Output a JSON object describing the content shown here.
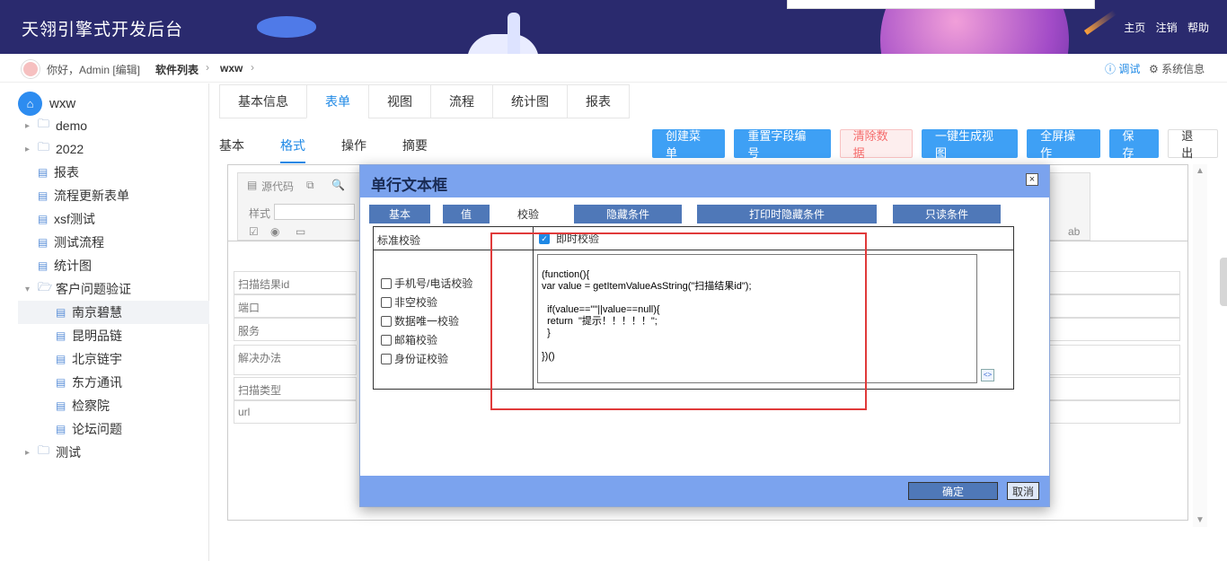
{
  "header": {
    "title": "天翎引擎式开发后台",
    "links": [
      "主页",
      "注销",
      "帮助"
    ]
  },
  "crumbs": {
    "greeting": "你好，Admin [编辑]",
    "items": [
      "软件列表",
      "wxw"
    ],
    "debug": "ⓘ 调试",
    "sysinfo": "⚙ 系统信息"
  },
  "sidebar": {
    "root": "wxw",
    "items": [
      {
        "label": "demo",
        "type": "folder"
      },
      {
        "label": "2022",
        "type": "folder"
      },
      {
        "label": "报表",
        "type": "doc"
      },
      {
        "label": "流程更新表单",
        "type": "doc"
      },
      {
        "label": "xsf测试",
        "type": "doc"
      },
      {
        "label": "测试流程",
        "type": "doc"
      },
      {
        "label": "统计图",
        "type": "doc"
      },
      {
        "label": "客户问题验证",
        "type": "folder-open"
      },
      {
        "label": "南京碧慧",
        "type": "doc-child",
        "active": true
      },
      {
        "label": "昆明品链",
        "type": "doc-child"
      },
      {
        "label": "北京链宇",
        "type": "doc-child"
      },
      {
        "label": "东方通讯",
        "type": "doc-child"
      },
      {
        "label": "检察院",
        "type": "doc-child"
      },
      {
        "label": "论坛问题",
        "type": "doc-child"
      },
      {
        "label": "测试",
        "type": "folder"
      }
    ]
  },
  "tabs": [
    "基本信息",
    "表单",
    "视图",
    "流程",
    "统计图",
    "报表"
  ],
  "active_tab": "表单",
  "subtabs": [
    "基本",
    "格式",
    "操作",
    "摘要"
  ],
  "active_subtab": "格式",
  "actions": [
    "创建菜单",
    "重置字段编号",
    "清除数据",
    "一键生成视图",
    "全屏操作",
    "保存",
    "退出"
  ],
  "toolbar": {
    "source": "源代码",
    "style_label": "样式"
  },
  "form_fields": [
    "扫描结果id",
    "端口",
    "服务",
    "解决办法",
    "扫描类型",
    "url"
  ],
  "dialog": {
    "title": "单行文本框",
    "close": "×",
    "tabs": [
      "基本",
      "值",
      "校验",
      "隐藏条件",
      "打印时隐藏条件",
      "只读条件"
    ],
    "active_tab": "校验",
    "standard_label": "标准校验",
    "instant_label": "即时校验",
    "instant_checked": true,
    "options": [
      "手机号/电话校验",
      "非空校验",
      "数据唯一校验",
      "邮箱校验",
      "身份证校验"
    ],
    "code": "(function(){\nvar value = getItemValueAsString(\"扫描结果id\");\n\n  if(value==\"\"||value==null){\n  return  \"提示！！！！！\";\n  }\n\n})()",
    "code_btn": "<>",
    "ok": "确定",
    "cancel": "取消"
  }
}
